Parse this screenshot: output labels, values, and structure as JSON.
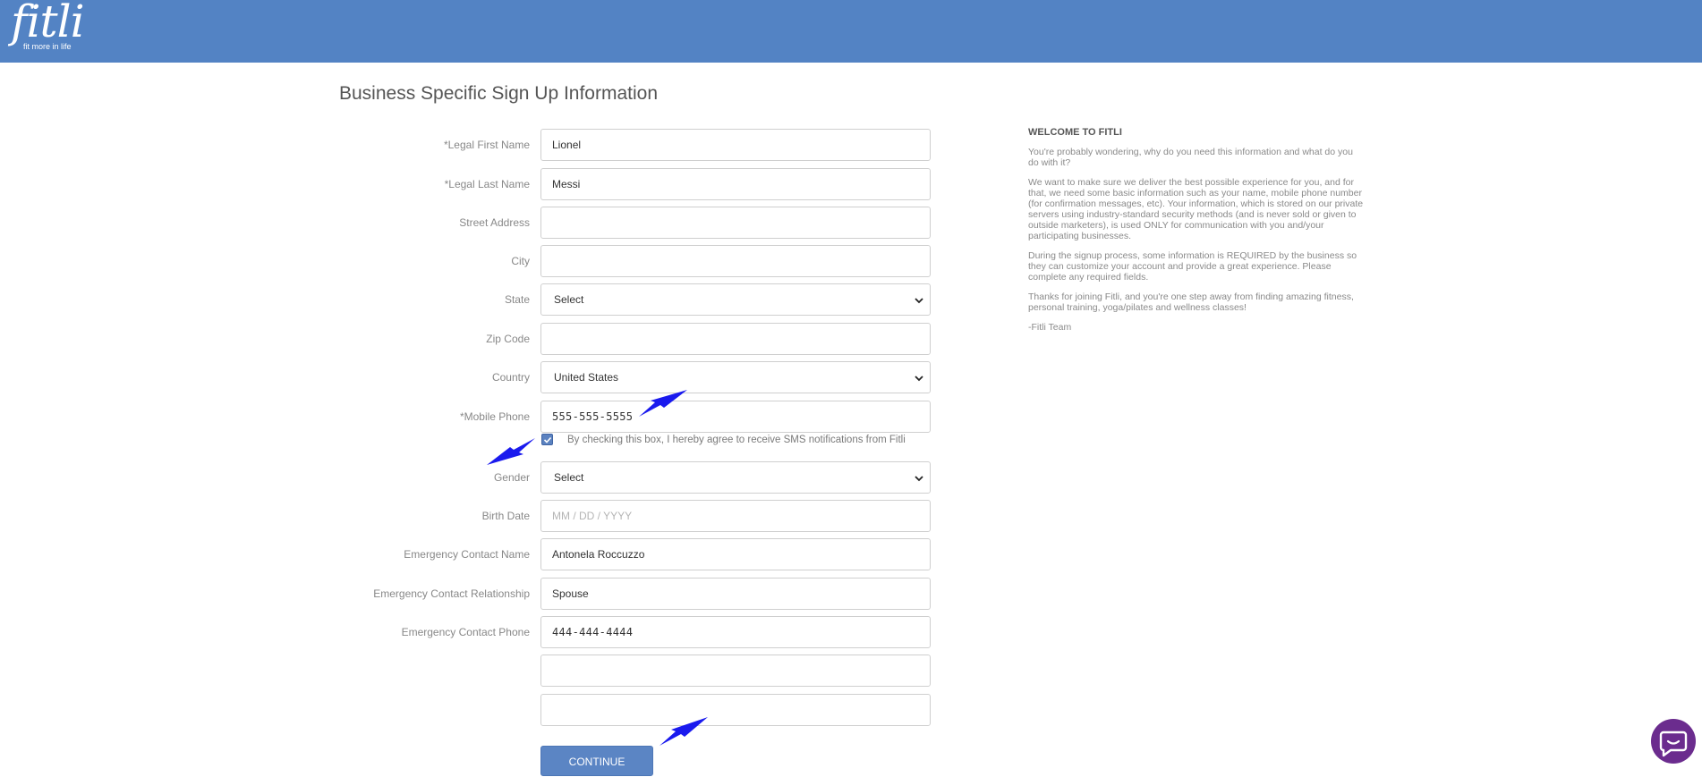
{
  "header": {
    "logo_word": "fitli",
    "logo_tagline": "fit more in life"
  },
  "page_title": "Business Specific Sign Up Information",
  "form": {
    "first_name": {
      "label": "*Legal First Name",
      "value": "Lionel"
    },
    "last_name": {
      "label": "*Legal Last Name",
      "value": "Messi"
    },
    "street": {
      "label": "Street Address",
      "value": ""
    },
    "city": {
      "label": "City",
      "value": ""
    },
    "state": {
      "label": "State",
      "value": "Select"
    },
    "zip": {
      "label": "Zip Code",
      "value": ""
    },
    "country": {
      "label": "Country",
      "value": "United States"
    },
    "mobile": {
      "label": "*Mobile Phone",
      "value": "555-555-5555"
    },
    "sms_consent": {
      "text": "By checking this box, I hereby agree to receive SMS notifications from Fitli",
      "checked": true
    },
    "gender": {
      "label": "Gender",
      "value": "Select"
    },
    "birth_date": {
      "label": "Birth Date",
      "placeholder": "MM / DD / YYYY"
    },
    "emergency_name": {
      "label": "Emergency Contact Name",
      "value": "Antonela Roccuzzo"
    },
    "emergency_relationship": {
      "label": "Emergency Contact Relationship",
      "value": "Spouse"
    },
    "emergency_phone": {
      "label": "Emergency Contact Phone",
      "value": "444-444-4444"
    },
    "extra1": {
      "value": ""
    },
    "extra2": {
      "value": ""
    },
    "continue_label": "CONTINUE"
  },
  "welcome": {
    "heading": "WELCOME TO FITLI",
    "p1": "You're probably wondering, why do you need this information and what do you do with it?",
    "p2": "We want to make sure we deliver the best possible experience for you, and for that, we need some basic information such as your name, mobile phone number (for confirmation messages, etc).  Your information, which is stored on our private servers using industry-standard security methods (and is never sold or given to outside marketers), is used ONLY for communication with you and/your participating businesses.",
    "p3": "During the signup process, some information is REQUIRED by the business so they can customize your account and provide a great experience.  Please complete any required fields.",
    "p4": "Thanks for joining Fitli, and you're one step away from finding amazing fitness, personal training, yoga/pilates and wellness classes!",
    "p5": "-Fitli Team"
  },
  "colors": {
    "header": "#5383c4",
    "button": "#5b85c4",
    "chat": "#6b2c8e",
    "arrow": "#1a1aee"
  },
  "icons": [
    "chevron-down-icon",
    "checkmark-icon",
    "arrow-annotation-icon",
    "chat-bubble-icon"
  ]
}
